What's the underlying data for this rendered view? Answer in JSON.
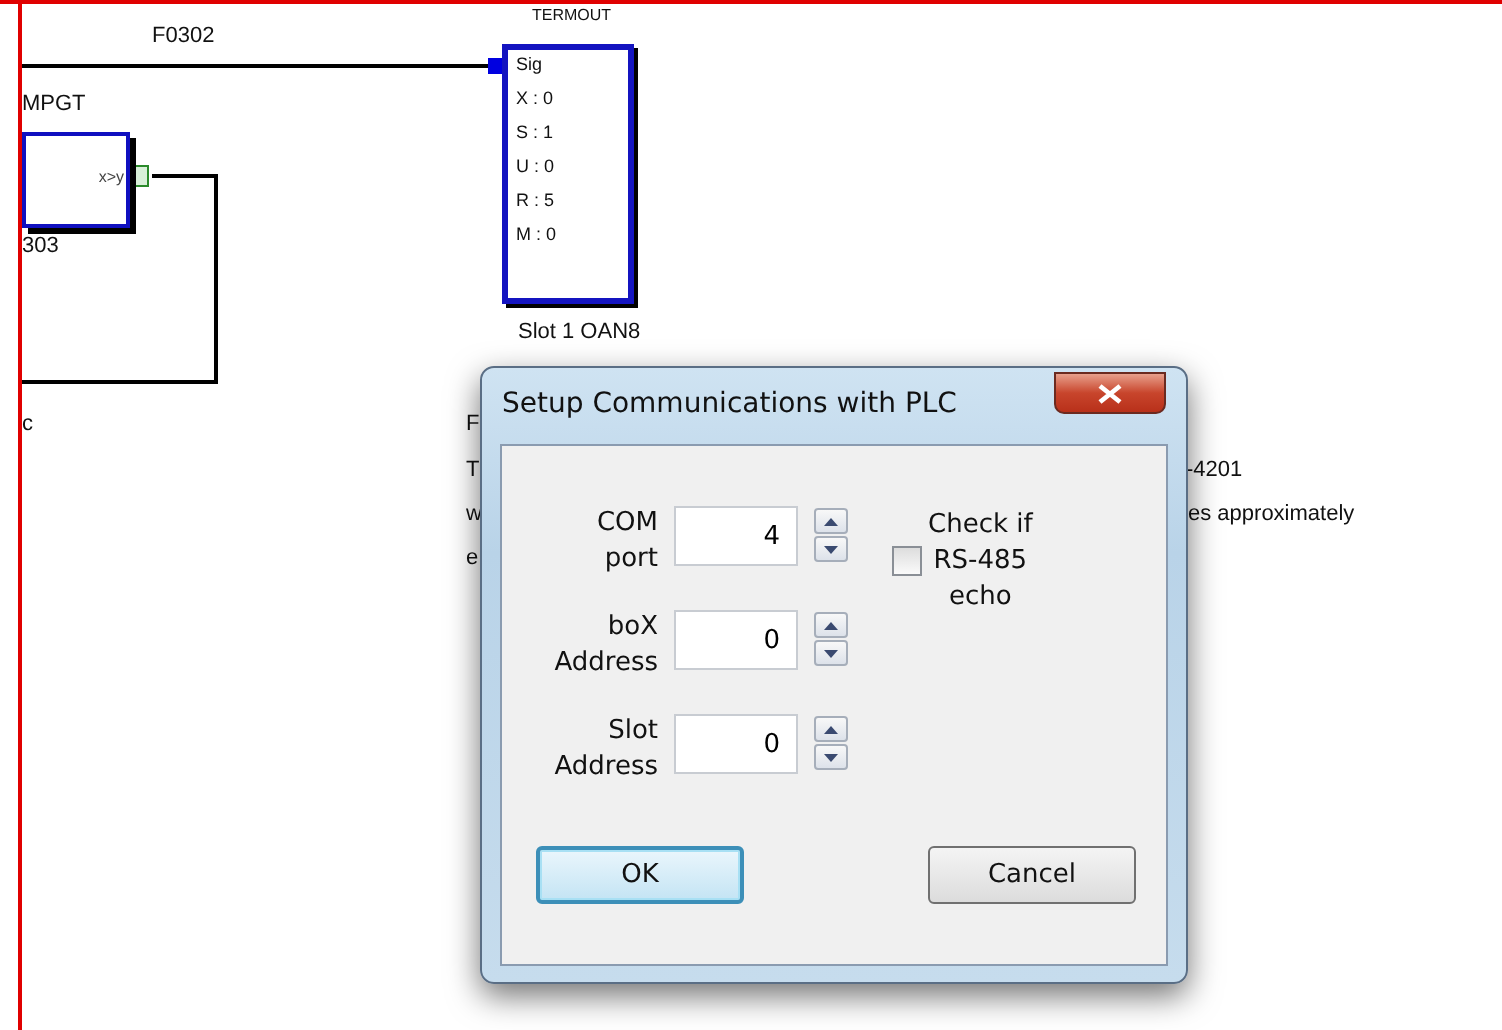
{
  "canvas": {
    "wire_label": "F0302",
    "blocks": [
      {
        "kind": "compare",
        "title": "MPGT",
        "output": "x>y",
        "tag": "303"
      },
      {
        "kind": "output",
        "title": "TERMOUT",
        "input": "Sig",
        "params": [
          "X : 0",
          "S : 1",
          "U : 0",
          "R : 5",
          "M : 0"
        ],
        "tag": "Slot 1 OAN8"
      }
    ],
    "notes": [
      "c",
      "F",
      "T",
      "w",
      "e",
      "-4201",
      "es approximately"
    ]
  },
  "dialog": {
    "title": "Setup Communications with PLC",
    "fields": [
      {
        "label": "COM\nport",
        "value": "4"
      },
      {
        "label": "boX\nAddress",
        "value": "0"
      },
      {
        "label": "Slot\nAddress",
        "value": "0"
      }
    ],
    "checkbox": {
      "label": "Check if\nRS-485\necho",
      "checked": false
    },
    "buttons": [
      {
        "label": "OK",
        "default": true
      },
      {
        "label": "Cancel",
        "default": false
      }
    ]
  }
}
